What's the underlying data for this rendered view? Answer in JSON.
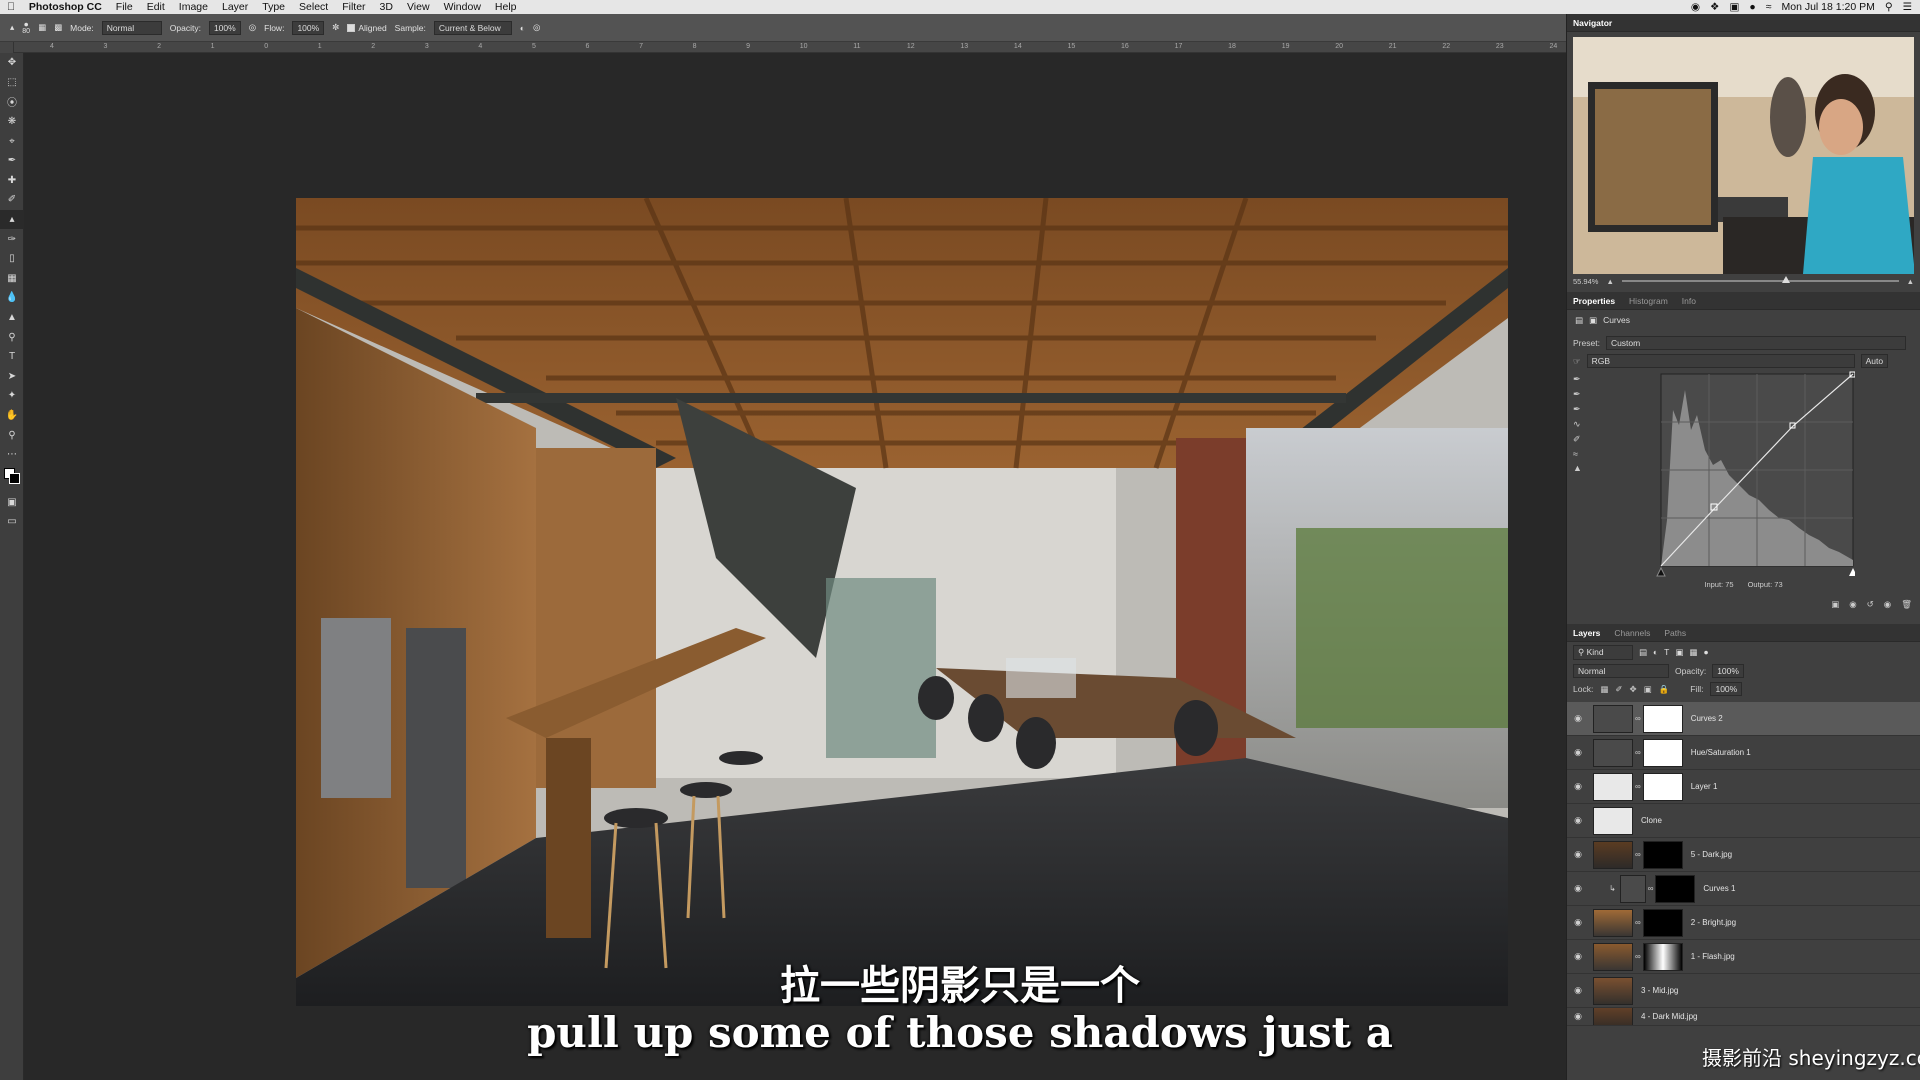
{
  "menubar": {
    "app": "Photoshop CC",
    "items": [
      "File",
      "Edit",
      "Image",
      "Layer",
      "Type",
      "Select",
      "Filter",
      "3D",
      "View",
      "Window",
      "Help"
    ],
    "clock": "Mon Jul 18  1:20 PM"
  },
  "options": {
    "brush_size": "80",
    "mode_label": "Mode:",
    "mode_value": "Normal",
    "opacity_label": "Opacity:",
    "opacity_value": "100%",
    "flow_label": "Flow:",
    "flow_value": "100%",
    "aligned_label": "Aligned",
    "sample_label": "Sample:",
    "sample_value": "Current & Below"
  },
  "ruler": {
    "ticks": [
      "4",
      "3",
      "2",
      "1",
      "0",
      "1",
      "2",
      "3",
      "4",
      "5",
      "6",
      "7",
      "8",
      "9",
      "10",
      "11",
      "12",
      "13",
      "14",
      "15",
      "16",
      "17",
      "18",
      "19",
      "20",
      "21",
      "22",
      "23",
      "24"
    ]
  },
  "navigator": {
    "title": "Navigator",
    "zoom": "55.94%"
  },
  "properties": {
    "tabs": [
      "Properties",
      "Histogram",
      "Info"
    ],
    "active_tab": "Properties",
    "adjustment": "Curves",
    "preset_label": "Preset:",
    "preset_value": "Custom",
    "channel": "RGB",
    "auto_label": "Auto",
    "input_label": "Input:",
    "input_value": "75",
    "output_label": "Output:",
    "output_value": "73"
  },
  "layers_panel": {
    "tabs": [
      "Layers",
      "Channels",
      "Paths"
    ],
    "kind_label": "Kind",
    "blend_mode": "Normal",
    "opacity_label": "Opacity:",
    "opacity_value": "100%",
    "lock_label": "Lock:",
    "fill_label": "Fill:",
    "fill_value": "100%",
    "layers": [
      {
        "name": "Curves 2",
        "selected": true
      },
      {
        "name": "Hue/Saturation 1",
        "selected": false
      },
      {
        "name": "Layer 1",
        "selected": false
      },
      {
        "name": "Clone",
        "selected": false
      },
      {
        "name": "5 - Dark.jpg",
        "selected": false
      },
      {
        "name": "Curves 1",
        "selected": false
      },
      {
        "name": "2 - Bright.jpg",
        "selected": false
      },
      {
        "name": "1 - Flash.jpg",
        "selected": false
      },
      {
        "name": "3 - Mid.jpg",
        "selected": false
      },
      {
        "name": "4 - Dark Mid.jpg",
        "selected": false
      }
    ]
  },
  "subtitles": {
    "chinese": "拉一些阴影只是一个",
    "english": "pull up some of those shadows just a"
  },
  "watermark": "摄影前沿 sheyingzyz.com",
  "colors": {
    "panel_bg": "#404040",
    "canvas_bg": "#282828",
    "menubar_bg": "#e6e6e6"
  }
}
